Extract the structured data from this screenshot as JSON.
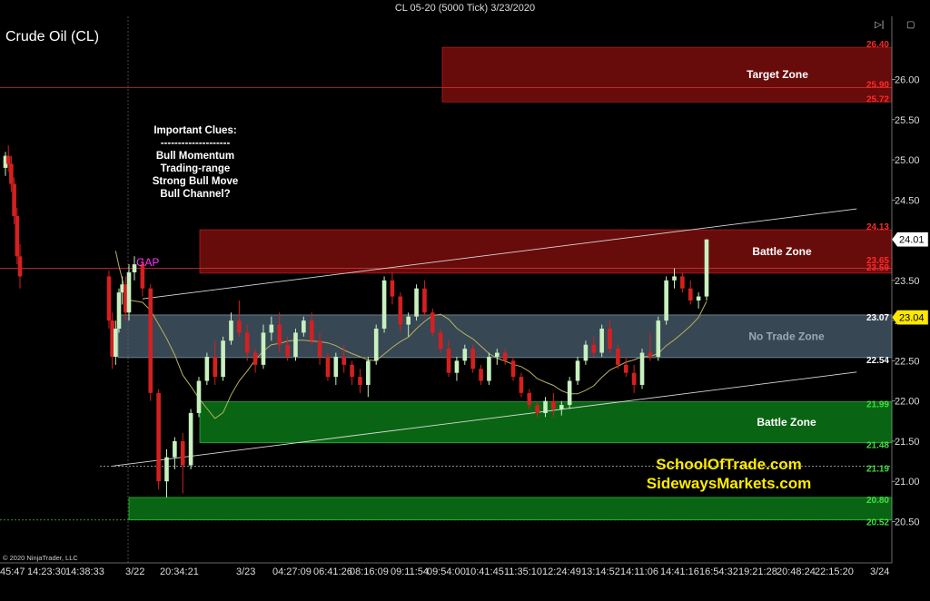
{
  "window_title": "CL 05-20 (5000 Tick)  3/23/2020",
  "instrument": "Crude Oil (CL)",
  "clues": {
    "heading": "Important Clues:",
    "separator": "--------------------",
    "items": [
      "Bull Momentum",
      "Trading-range",
      "Strong Bull Move",
      "Bull Channel?"
    ]
  },
  "gap_label": "GAP",
  "brand": {
    "line1": "SchoolOfTrade.com",
    "line2": "SidewaysMarkets.com"
  },
  "copyright": "© 2020 NinjaTrader, LLC",
  "nav_icons": [
    "play-end-icon",
    "expand-icon"
  ],
  "colors": {
    "background": "#000000",
    "bull_candle": "#c8f0c0",
    "bear_candle": "#d42020",
    "resistance_zone": "#6e0c0c",
    "support_zone": "#0a6a14",
    "no_trade_zone": "#4a5f70",
    "brand_text": "#ffeb00",
    "gap_text": "#ff33ff",
    "price_marker": "#ffe800"
  },
  "chart_data": {
    "type": "candlestick",
    "title": "CL 05-20 (5000 Tick)  3/23/2020",
    "ylim": [
      20.37,
      26.48
    ],
    "y_ticks": [
      "26.00",
      "25.50",
      "25.00",
      "24.50",
      "24.00",
      "23.50",
      "23.00",
      "22.50",
      "22.00",
      "21.50",
      "21.00",
      "20.50"
    ],
    "x_tick_labels": [
      "45:47",
      "14:23:30",
      "14:38:33",
      "3/22",
      "20:34:21",
      "3/23",
      "04:27:09",
      "06:41:26",
      "08:16:09",
      "09:11:54",
      "09:54:00",
      "10:41:45",
      "11:35:10",
      "12:24:49",
      "13:14:52",
      "14:11:06",
      "14:41:16",
      "16:54:32",
      "19:21:28",
      "20:48:24",
      "22:15:20",
      "3/24"
    ],
    "session_breaks": [
      "3/22",
      "3/23"
    ],
    "zones": [
      {
        "name": "Target Zone",
        "top": 26.4,
        "bottom": 25.72,
        "inner_line": 25.9,
        "side": "resistance"
      },
      {
        "name": "Battle Zone",
        "top": 24.13,
        "bottom": 23.59,
        "inner_line": 23.65,
        "side": "resistance"
      },
      {
        "name": "No Trade Zone",
        "top": 23.07,
        "bottom": 22.54,
        "side": "neutral"
      },
      {
        "name": "Battle Zone",
        "top": 21.99,
        "bottom": 21.48,
        "side": "support"
      },
      {
        "name": "",
        "top": 20.8,
        "bottom": 20.52,
        "side": "support"
      }
    ],
    "level_labels": [
      {
        "value": "26.40",
        "color": "red"
      },
      {
        "value": "25.90",
        "color": "red"
      },
      {
        "value": "25.72",
        "color": "red"
      },
      {
        "value": "24.13",
        "color": "red"
      },
      {
        "value": "23.65",
        "color": "red"
      },
      {
        "value": "23.59",
        "color": "red"
      },
      {
        "value": "23.07",
        "color": "white"
      },
      {
        "value": "22.54",
        "color": "white"
      },
      {
        "value": "21.99",
        "color": "green"
      },
      {
        "value": "21.48",
        "color": "green"
      },
      {
        "value": "21.19",
        "color": "green"
      },
      {
        "value": "20.80",
        "color": "green"
      },
      {
        "value": "20.52",
        "color": "green"
      }
    ],
    "price_markers": [
      {
        "value": "24.01",
        "style": "last-price"
      },
      {
        "value": "23.04",
        "style": "moving-average"
      }
    ],
    "trendlines": [
      {
        "from_bar": 14,
        "from_price": 23.27,
        "to_bar": 103,
        "to_price": 24.39
      },
      {
        "from_bar": 7,
        "from_price": 21.19,
        "to_bar": 103,
        "to_price": 22.36
      }
    ],
    "horizontal_lines": [
      {
        "price": 25.9,
        "start_bar": 0
      },
      {
        "price": 23.65,
        "start_bar": 0
      },
      {
        "price": 21.19,
        "start_bar": 6,
        "dashed": true
      },
      {
        "price": 20.52,
        "start_bar": 0,
        "dashed": true
      }
    ],
    "candles": [
      [
        24.9,
        25.1,
        24.8,
        25.05
      ],
      [
        25.05,
        25.18,
        24.85,
        24.95
      ],
      [
        24.95,
        25.05,
        24.6,
        24.7
      ],
      [
        24.7,
        24.78,
        24.2,
        24.3
      ],
      [
        24.3,
        24.4,
        23.7,
        23.8
      ],
      [
        23.8,
        23.95,
        23.4,
        23.55
      ],
      [
        23.55,
        23.62,
        22.9,
        23.0
      ],
      [
        23.0,
        23.1,
        22.4,
        22.55
      ],
      [
        22.55,
        23.0,
        22.45,
        22.9
      ],
      [
        22.9,
        23.4,
        22.85,
        23.35
      ],
      [
        23.35,
        23.55,
        23.2,
        23.45
      ],
      [
        23.45,
        23.55,
        23.0,
        23.1
      ],
      [
        23.1,
        23.7,
        23.0,
        23.6
      ],
      [
        23.6,
        23.8,
        23.5,
        23.7
      ],
      [
        23.7,
        23.78,
        23.3,
        23.4
      ],
      [
        23.4,
        23.45,
        22.0,
        22.1
      ],
      [
        22.1,
        22.15,
        20.9,
        21.0
      ],
      [
        21.0,
        21.4,
        20.8,
        21.3
      ],
      [
        21.3,
        21.55,
        21.15,
        21.5
      ],
      [
        21.5,
        21.6,
        20.85,
        21.2
      ],
      [
        21.2,
        21.9,
        21.15,
        21.85
      ],
      [
        21.85,
        22.3,
        21.8,
        22.25
      ],
      [
        22.25,
        22.6,
        22.2,
        22.55
      ],
      [
        22.55,
        22.75,
        22.2,
        22.3
      ],
      [
        22.3,
        22.8,
        22.25,
        22.75
      ],
      [
        22.75,
        23.1,
        22.7,
        23.0
      ],
      [
        23.0,
        23.25,
        22.8,
        22.85
      ],
      [
        22.85,
        22.95,
        22.5,
        22.6
      ],
      [
        22.6,
        22.65,
        22.35,
        22.45
      ],
      [
        22.45,
        22.95,
        22.4,
        22.85
      ],
      [
        22.85,
        23.05,
        22.75,
        22.95
      ],
      [
        22.95,
        23.1,
        22.6,
        22.7
      ],
      [
        22.7,
        22.8,
        22.5,
        22.55
      ],
      [
        22.55,
        22.9,
        22.5,
        22.85
      ],
      [
        22.85,
        23.05,
        22.8,
        23.0
      ],
      [
        23.0,
        23.1,
        22.7,
        22.75
      ],
      [
        22.75,
        22.85,
        22.45,
        22.55
      ],
      [
        22.55,
        22.6,
        22.25,
        22.3
      ],
      [
        22.3,
        22.6,
        22.2,
        22.55
      ],
      [
        22.55,
        22.7,
        22.35,
        22.45
      ],
      [
        22.45,
        22.5,
        22.2,
        22.3
      ],
      [
        22.3,
        22.4,
        22.1,
        22.2
      ],
      [
        22.2,
        22.55,
        22.05,
        22.5
      ],
      [
        22.5,
        22.95,
        22.45,
        22.9
      ],
      [
        22.9,
        23.55,
        22.85,
        23.5
      ],
      [
        23.5,
        23.6,
        23.2,
        23.3
      ],
      [
        23.3,
        23.35,
        22.85,
        22.95
      ],
      [
        22.95,
        23.1,
        22.8,
        23.05
      ],
      [
        23.05,
        23.45,
        23.0,
        23.4
      ],
      [
        23.4,
        23.5,
        23.05,
        23.1
      ],
      [
        23.1,
        23.15,
        22.8,
        22.85
      ],
      [
        22.85,
        22.9,
        22.6,
        22.65
      ],
      [
        22.65,
        22.75,
        22.3,
        22.35
      ],
      [
        22.35,
        22.55,
        22.25,
        22.5
      ],
      [
        22.5,
        22.7,
        22.45,
        22.65
      ],
      [
        22.65,
        22.7,
        22.35,
        22.4
      ],
      [
        22.4,
        22.45,
        22.2,
        22.25
      ],
      [
        22.25,
        22.6,
        22.2,
        22.55
      ],
      [
        22.55,
        22.65,
        22.45,
        22.6
      ],
      [
        22.6,
        22.65,
        22.45,
        22.5
      ],
      [
        22.5,
        22.55,
        22.25,
        22.3
      ],
      [
        22.3,
        22.35,
        22.05,
        22.1
      ],
      [
        22.1,
        22.15,
        21.9,
        21.95
      ],
      [
        21.95,
        22.0,
        21.8,
        21.85
      ],
      [
        21.85,
        22.05,
        21.8,
        22.0
      ],
      [
        22.0,
        22.1,
        21.8,
        21.9
      ],
      [
        21.9,
        22.0,
        21.82,
        21.95
      ],
      [
        21.95,
        22.3,
        21.9,
        22.25
      ],
      [
        22.25,
        22.55,
        22.2,
        22.5
      ],
      [
        22.5,
        22.75,
        22.45,
        22.7
      ],
      [
        22.7,
        22.8,
        22.55,
        22.6
      ],
      [
        22.6,
        22.95,
        22.55,
        22.9
      ],
      [
        22.9,
        23.0,
        22.6,
        22.65
      ],
      [
        22.65,
        22.7,
        22.4,
        22.45
      ],
      [
        22.45,
        22.55,
        22.3,
        22.35
      ],
      [
        22.35,
        22.45,
        22.1,
        22.2
      ],
      [
        22.2,
        22.65,
        22.15,
        22.6
      ],
      [
        22.6,
        22.85,
        22.5,
        22.55
      ],
      [
        22.55,
        23.05,
        22.5,
        23.0
      ],
      [
        23.0,
        23.55,
        22.95,
        23.5
      ],
      [
        23.5,
        23.65,
        23.4,
        23.55
      ],
      [
        23.55,
        23.6,
        23.35,
        23.4
      ],
      [
        23.4,
        23.5,
        23.2,
        23.25
      ],
      [
        23.25,
        23.35,
        23.15,
        23.3
      ],
      [
        23.3,
        24.01,
        23.25,
        24.01
      ]
    ]
  }
}
